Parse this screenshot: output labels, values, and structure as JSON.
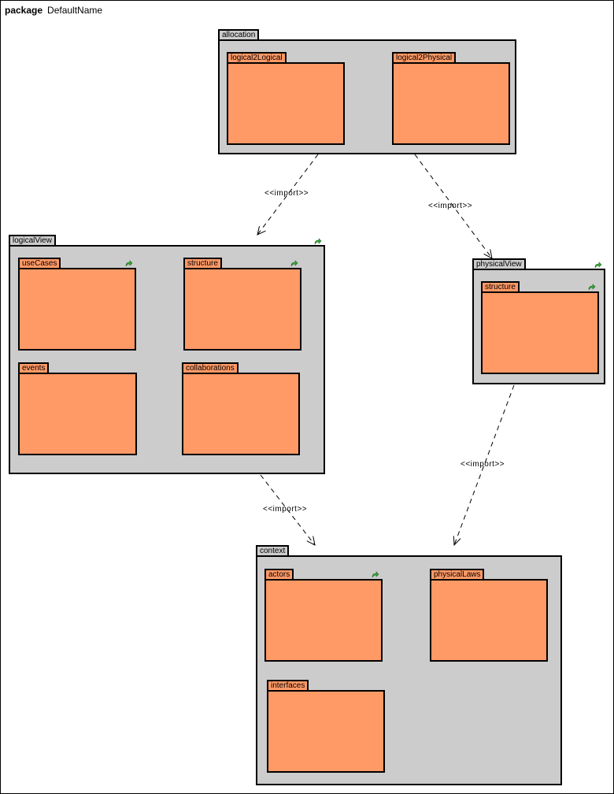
{
  "frame": {
    "keyword": "package",
    "name": "DefaultName"
  },
  "packages": {
    "allocation": {
      "name": "allocation",
      "children": {
        "logical2Logical": "logical2Logical",
        "logical2Physical": "logical2Physical"
      }
    },
    "logicalView": {
      "name": "logicalView",
      "children": {
        "useCases": "useCases",
        "structure": "structure",
        "events": "events",
        "collaborations": "collaborations"
      }
    },
    "physicalView": {
      "name": "physicalView",
      "children": {
        "structure": "structure"
      }
    },
    "context": {
      "name": "context",
      "children": {
        "actors": "actors",
        "physicalLaws": "physicalLaws",
        "interfaces": "interfaces"
      }
    }
  },
  "dependencies": [
    {
      "from": "allocation",
      "to": "logicalView",
      "label": "<<import>>"
    },
    {
      "from": "allocation",
      "to": "physicalView",
      "label": "<<import>>"
    },
    {
      "from": "logicalView",
      "to": "context",
      "label": "<<import>>"
    },
    {
      "from": "physicalView",
      "to": "context",
      "label": "<<import>>"
    }
  ],
  "icons": {
    "reference": "hyperlink-arrow-icon"
  },
  "colors": {
    "outer_package": "#cccccc",
    "inner_package": "#ff9966",
    "ref_icon": "#33aa33"
  }
}
